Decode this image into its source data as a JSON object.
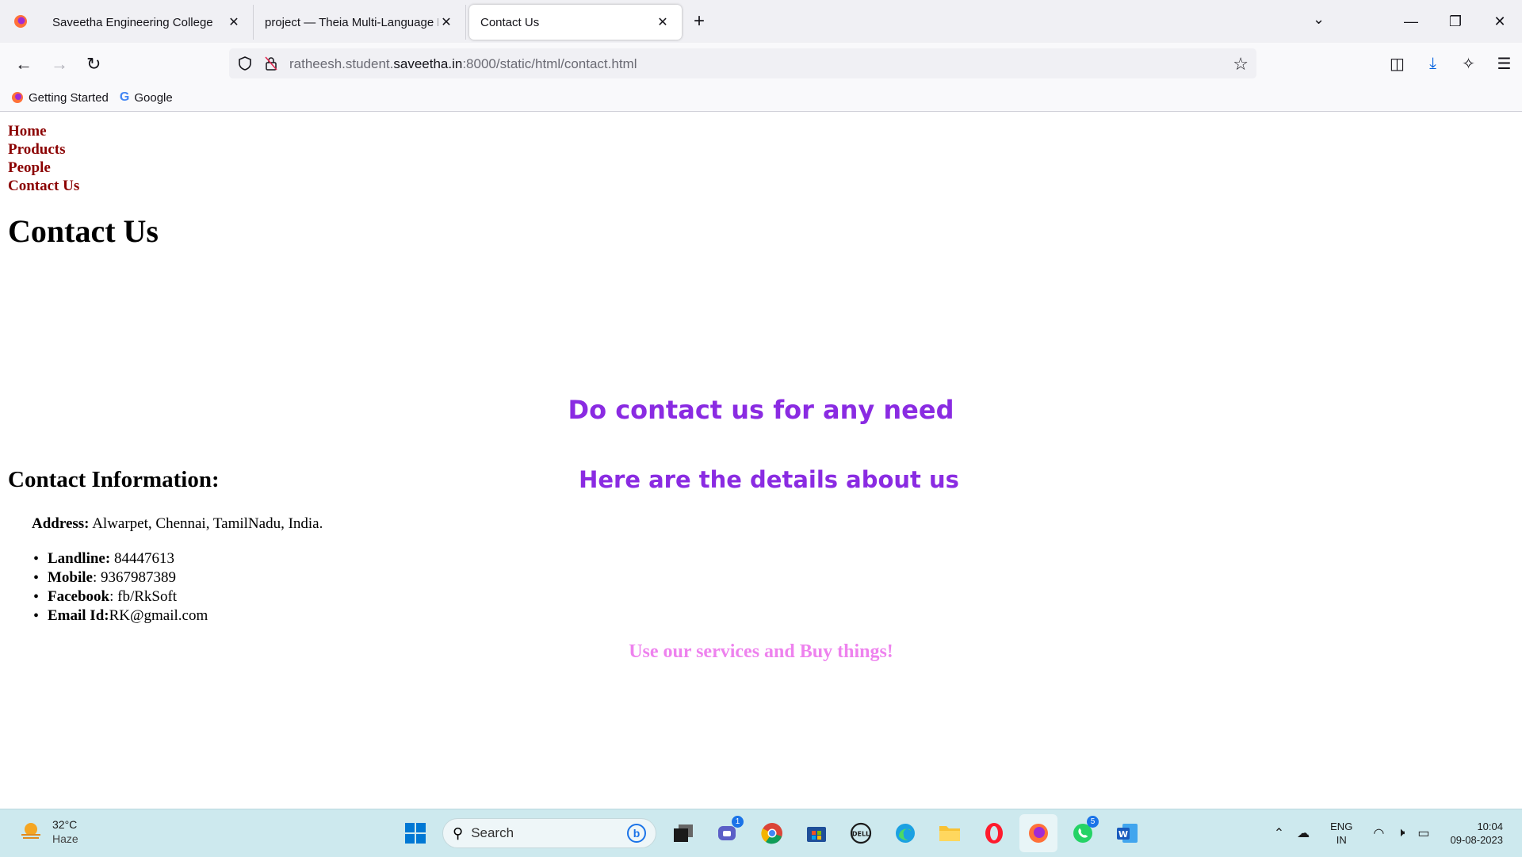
{
  "browser": {
    "tabs": [
      {
        "label": "Saveetha Engineering College"
      },
      {
        "label": "project — Theia Multi-Language Ex"
      },
      {
        "label": "Contact Us"
      }
    ],
    "url": {
      "prefix": "ratheesh.student.",
      "domain": "saveetha.in",
      "suffix": ":8000/static/html/contact.html"
    },
    "bookmarks": [
      {
        "label": "Getting Started"
      },
      {
        "label": "Google"
      }
    ]
  },
  "page": {
    "nav": [
      "Home",
      "Products",
      "People",
      "Contact Us"
    ],
    "title": "Contact Us",
    "heading_details": "Here are the details about us",
    "heading_contact": "Do contact us for any need",
    "info_title": "Contact Information:",
    "address_label": "Address:",
    "address_value": " Alwarpet, Chennai, TamilNadu, India.",
    "info": [
      {
        "label": "Landline:",
        "value": " 84447613"
      },
      {
        "label": "Mobile",
        "value": ": 9367987389"
      },
      {
        "label": "Facebook",
        "value": ": fb/RkSoft"
      },
      {
        "label": "Email Id:",
        "value": "RK@gmail.com"
      }
    ],
    "services": "Use our services and Buy things!"
  },
  "taskbar": {
    "weather_temp": "32°C",
    "weather_desc": "Haze",
    "search_placeholder": "Search",
    "badges": {
      "teams": "1",
      "whatsapp": "5"
    },
    "lang_top": "ENG",
    "lang_bottom": "IN",
    "time": "10:04",
    "date": "09-08-2023"
  },
  "colors": {
    "nav_link": "#8b0000",
    "heading_purple": "#8a2be2",
    "services_pink": "#ee82ee",
    "taskbar_bg": "#cde9ee"
  }
}
